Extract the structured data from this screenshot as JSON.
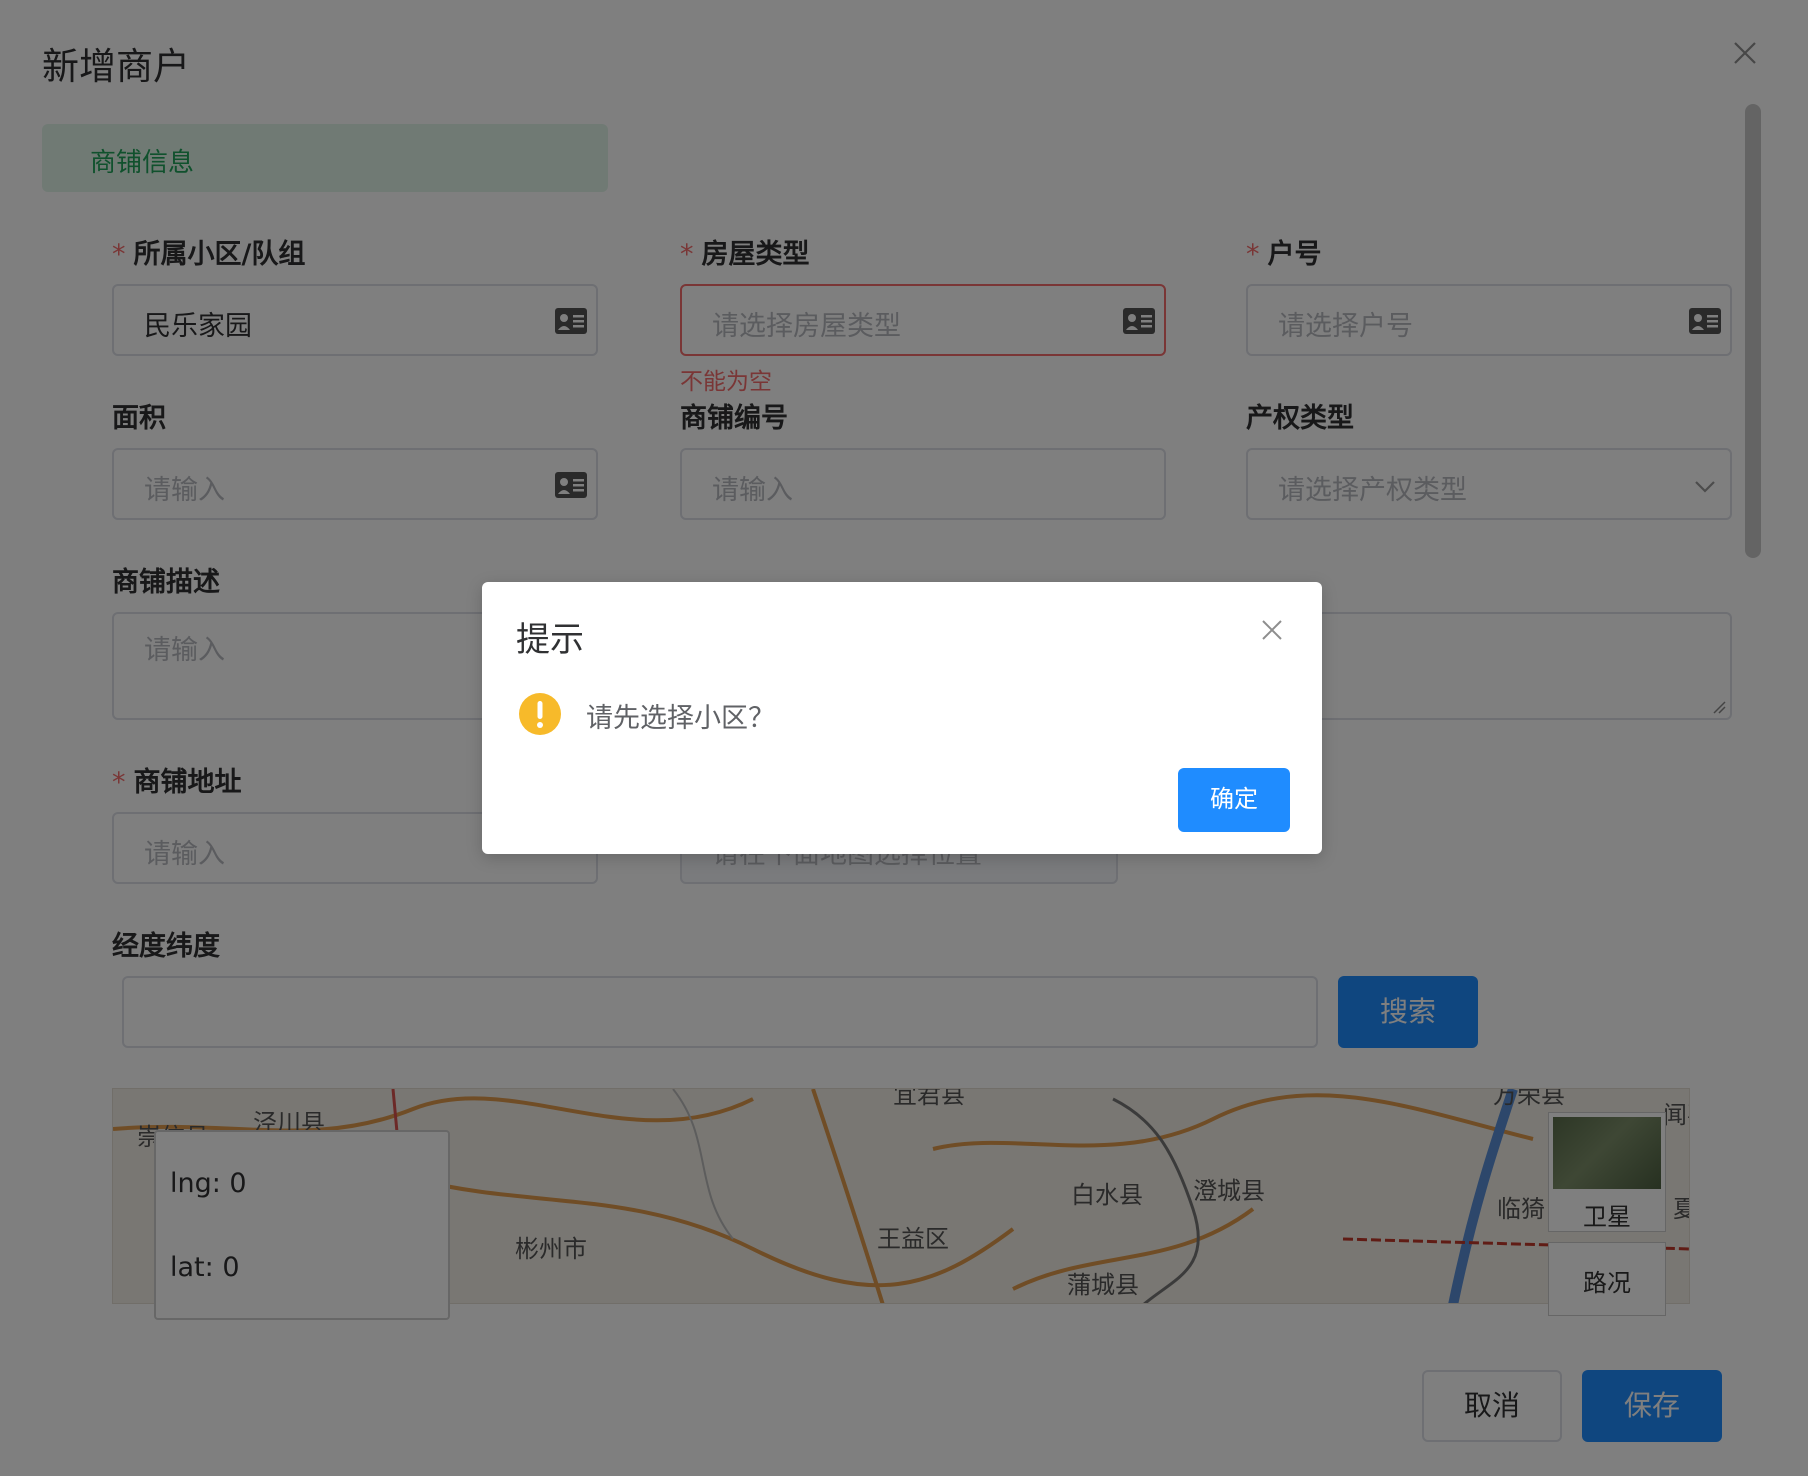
{
  "drawer": {
    "title": "新增商户",
    "section_title": "商铺信息"
  },
  "form": {
    "community": {
      "label": "所属小区/队组",
      "value": "民乐家园"
    },
    "house_type": {
      "label": "房屋类型",
      "placeholder": "请选择房屋类型",
      "error": "不能为空"
    },
    "house_no": {
      "label": "户号",
      "placeholder": "请选择户号"
    },
    "area": {
      "label": "面积",
      "placeholder": "请输入"
    },
    "shop_no": {
      "label": "商铺编号",
      "placeholder": "请输入"
    },
    "property_type": {
      "label": "产权类型",
      "placeholder": "请选择产权类型"
    },
    "description": {
      "label": "商铺描述",
      "placeholder": "请输入"
    },
    "address": {
      "label": "商铺地址",
      "placeholder": "请输入"
    },
    "location_hint": {
      "placeholder": "请在下面地图选择位置"
    },
    "lnglat": {
      "label": "经度纬度",
      "value": ""
    },
    "required_mark": "*"
  },
  "search": {
    "button_label": "搜索"
  },
  "map": {
    "lng_text": "lng: 0",
    "lat_text": "lat: 0",
    "type_label": "卫星",
    "traffic_label": "路况",
    "place_labels": [
      "泾川县",
      "崇信县",
      "彬州市",
      "王益区",
      "宜君县",
      "白水县",
      "澄城县",
      "蒲城县",
      "临猗",
      "夏",
      "闻喜",
      "万荣县"
    ]
  },
  "footer": {
    "cancel_label": "取消",
    "save_label": "保存"
  },
  "dialog": {
    "title": "提示",
    "message": "请先选择小区？",
    "confirm_label": "确定"
  },
  "colors": {
    "primary": "#1f8cff",
    "danger": "#f56c6c",
    "warning": "#f7ba2a",
    "success_text": "#20a35a",
    "success_bg": "#e1f5e9"
  },
  "icons": {
    "contact_card": "contact-card-icon",
    "chevron": "chevron-down-icon",
    "close": "close-icon",
    "warning": "warning-icon"
  }
}
